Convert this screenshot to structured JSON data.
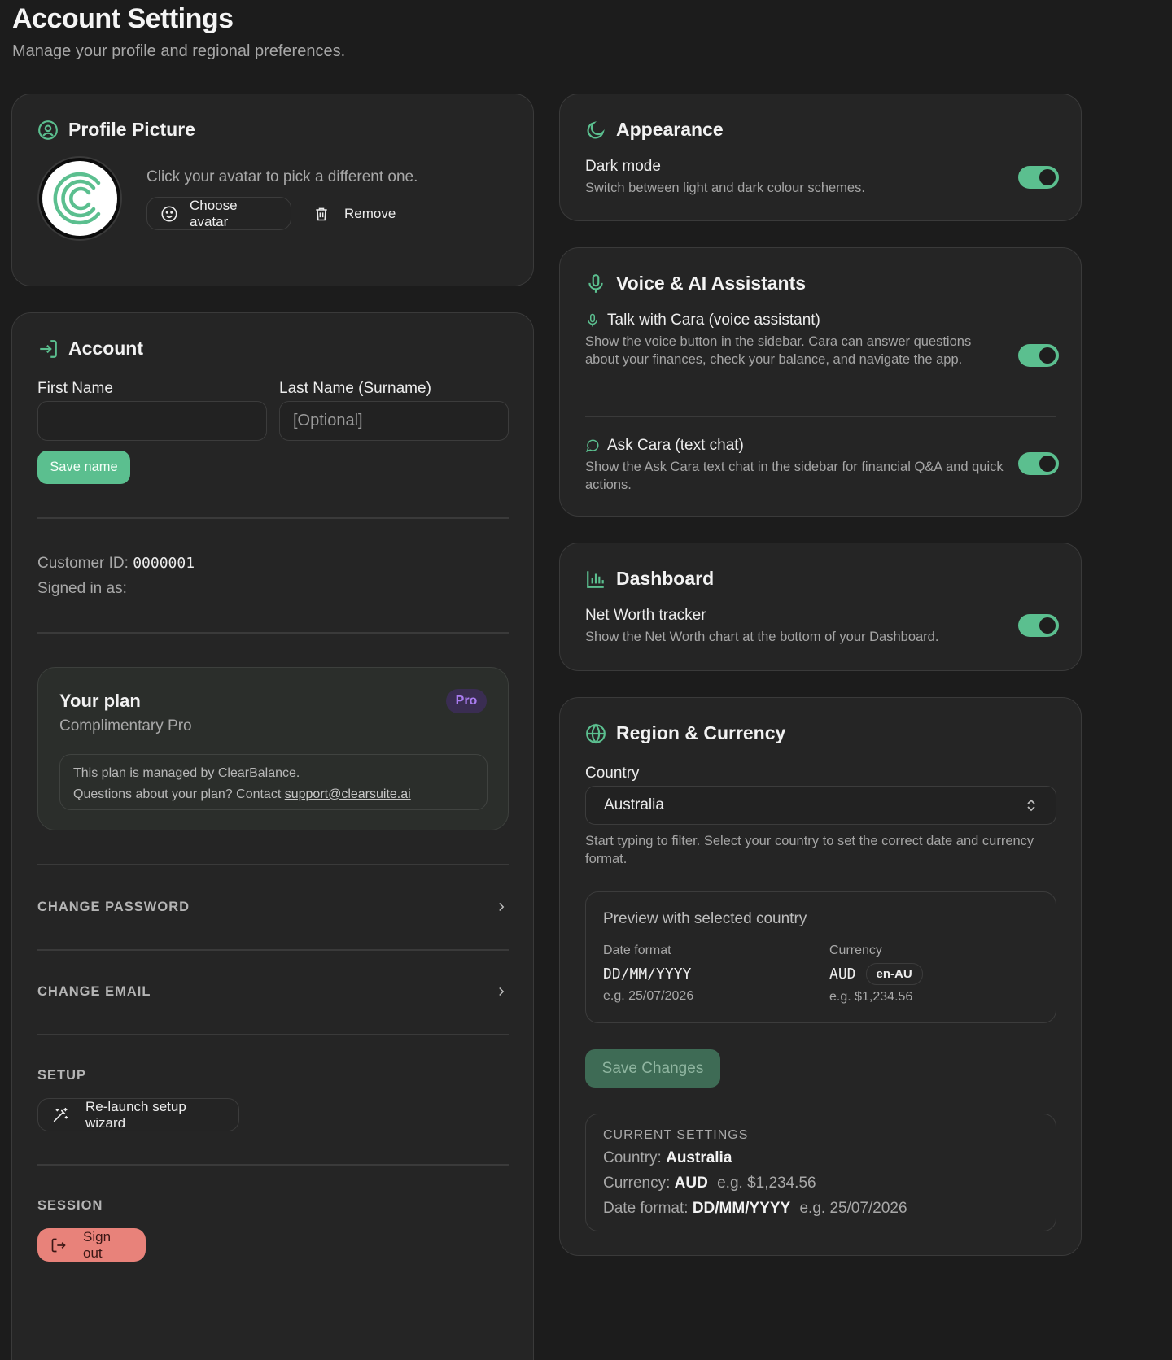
{
  "page": {
    "title": "Account Settings",
    "subtitle": "Manage your profile and regional preferences."
  },
  "profile": {
    "title": "Profile Picture",
    "hint": "Click your avatar to pick a different one.",
    "choose_label": "Choose avatar",
    "remove_label": "Remove"
  },
  "account": {
    "title": "Account",
    "first_name_label": "First Name",
    "first_name_value": "",
    "last_name_label": "Last Name (Surname)",
    "last_name_placeholder": "[Optional]",
    "save_name_label": "Save name",
    "customer_id_label": "Customer ID:",
    "customer_id_value": "0000001",
    "signed_in_label": "Signed in as:",
    "plan": {
      "title": "Your plan",
      "badge": "Pro",
      "name": "Complimentary Pro",
      "note_line1": "This plan is managed by ClearBalance.",
      "note_line2_prefix": "Questions about your plan? Contact ",
      "support_email": "support@clearsuite.ai"
    },
    "change_password_label": "CHANGE PASSWORD",
    "change_email_label": "CHANGE EMAIL",
    "setup_caption": "SETUP",
    "relaunch_label": "Re-launch setup wizard",
    "session_caption": "SESSION",
    "sign_out_label": "Sign out"
  },
  "appearance": {
    "title": "Appearance",
    "dark_mode_label": "Dark mode",
    "dark_mode_desc": "Switch between light and dark colour schemes.",
    "dark_mode_on": true
  },
  "voice": {
    "title": "Voice & AI Assistants",
    "talk_label": "Talk with Cara (voice assistant)",
    "talk_desc": "Show the voice button in the sidebar. Cara can answer questions about your finances, check your balance, and navigate the app.",
    "talk_on": true,
    "ask_label": "Ask Cara (text chat)",
    "ask_desc": "Show the Ask Cara text chat in the sidebar for financial Q&A and quick actions.",
    "ask_on": true
  },
  "dashboard": {
    "title": "Dashboard",
    "networth_label": "Net Worth tracker",
    "networth_desc": "Show the Net Worth chart at the bottom of your Dashboard.",
    "networth_on": true
  },
  "region": {
    "title": "Region & Currency",
    "country_label": "Country",
    "country_value": "Australia",
    "country_help": "Start typing to filter. Select your country to set the correct date and currency format.",
    "preview_title": "Preview with selected country",
    "date_format_label": "Date format",
    "date_format_value": "DD/MM/YYYY",
    "date_example": "e.g. 25/07/2026",
    "currency_label": "Currency",
    "currency_value": "AUD",
    "locale_badge": "en-AU",
    "currency_example": "e.g. $1,234.56",
    "save_label": "Save Changes",
    "current_caption": "CURRENT SETTINGS",
    "current_country_label": "Country:",
    "current_country_value": "Australia",
    "current_currency_label": "Currency:",
    "current_currency_value": "AUD",
    "current_currency_example": "e.g. $1,234.56",
    "current_date_label": "Date format:",
    "current_date_value": "DD/MM/YYYY",
    "current_date_example": "e.g. 25/07/2026"
  },
  "colors": {
    "accent": "#5bbf8f",
    "background": "#1c1c1c",
    "card": "#252525",
    "pro_badge": "#a97cf0",
    "sign_out": "#e8827a"
  }
}
